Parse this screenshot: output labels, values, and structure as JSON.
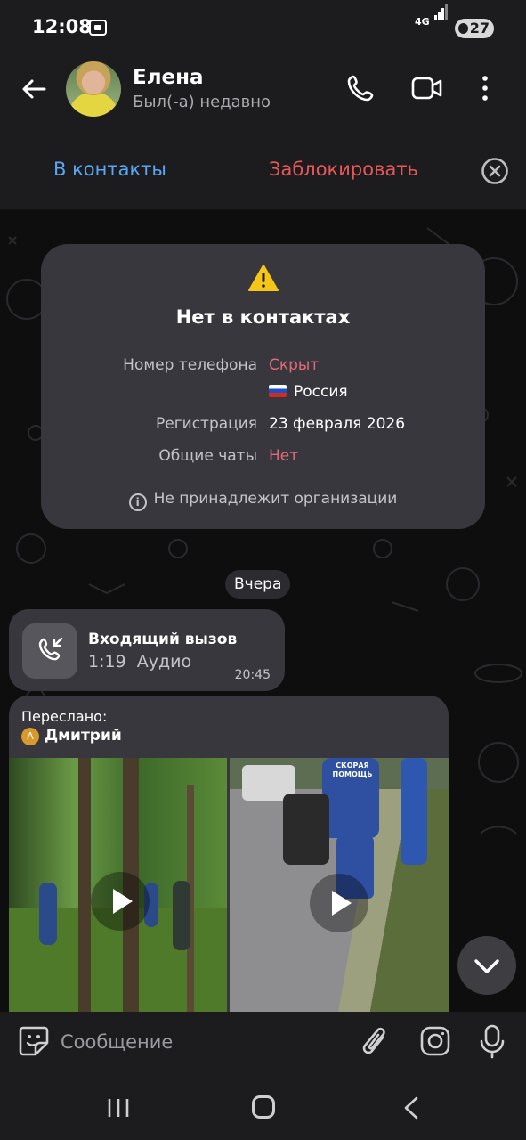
{
  "status_bar": {
    "time": "12:08",
    "network": "4G",
    "battery": "27"
  },
  "header": {
    "contact_name": "Елена",
    "last_seen": "Был(-а) недавно",
    "back_icon": "arrow-left-icon",
    "call_icon": "phone-icon",
    "video_icon": "video-camera-icon",
    "more_icon": "more-vertical-icon"
  },
  "action_bar": {
    "add_contact": "В контакты",
    "block": "Заблокировать",
    "close_icon": "close-circle-icon"
  },
  "info_card": {
    "title": "Нет в контактах",
    "rows": [
      {
        "label": "Номер телефона",
        "value": "Скрыт",
        "highlight": true
      },
      {
        "label": "",
        "value": "Россия",
        "flag": "ru"
      },
      {
        "label": "Регистрация",
        "value": "23 февраля 2026",
        "highlight": false
      },
      {
        "label": "Общие чаты",
        "value": "Нет",
        "highlight": true
      }
    ],
    "org_note": "Не принадлежит организации"
  },
  "date_separator": "Вчера",
  "call_message": {
    "title": "Входящий вызов",
    "duration": "1:19",
    "type": "Аудио",
    "time": "20:45"
  },
  "forwarded_message": {
    "label": "Переслано:",
    "from_badge": "A",
    "from": "Дмитрий",
    "videos": [
      {
        "name": "video-1",
        "overlay_text": ""
      },
      {
        "name": "video-2",
        "overlay_text": "СКОРАЯ ПОМОЩЬ"
      }
    ]
  },
  "composer": {
    "placeholder": "Сообщение",
    "emoji_icon": "sticker-icon",
    "attach_icon": "paperclip-icon",
    "camera_icon": "camera-icon",
    "mic_icon": "microphone-icon"
  },
  "colors": {
    "accent_blue": "#5aa8f5",
    "danger_red": "#e7575a",
    "highlight_pink": "#e46a77",
    "background": "#1c1c1e",
    "bubble": "#38373d"
  }
}
